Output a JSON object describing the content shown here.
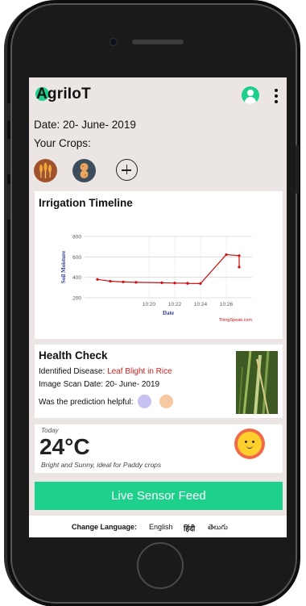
{
  "app": {
    "title": "AgriIoT"
  },
  "header": {
    "date": "Date: 20- June- 2019",
    "crops_label": "Your Crops:"
  },
  "crops": [
    {
      "icon": "wheat-crop-icon"
    },
    {
      "icon": "peanut-crop-icon"
    }
  ],
  "irrigation": {
    "title": "Irrigation Timeline"
  },
  "chart_data": {
    "type": "line",
    "title": "",
    "xlabel": "Date",
    "ylabel": "Soil Moisture",
    "x": [
      "10:16",
      "10:17",
      "10:18",
      "10:19",
      "10:21",
      "10:22",
      "10:23",
      "10:23",
      "10:24",
      "10:26",
      "10:27",
      "10:27"
    ],
    "y": [
      380,
      362,
      355,
      351,
      347,
      344,
      342,
      340,
      339,
      622,
      612,
      500
    ],
    "x_ticks": [
      "10:20",
      "10:22",
      "10:24",
      "10:26"
    ],
    "y_ticks": [
      200,
      400,
      600,
      800
    ],
    "ylim": [
      200,
      800
    ],
    "color": "#cc1010",
    "watermark": "ThingSpeak.com",
    "grid": true
  },
  "health": {
    "title": "Health Check",
    "disease_label": "Identified Disease: ",
    "disease_value": "Leaf Blight in Rice",
    "scan_date": "Image Scan Date: 20- June- 2019",
    "helpful_question": "Was the prediction helpful:"
  },
  "weather": {
    "day": "Today",
    "temperature": "24°C",
    "description": "Bright and Sunny, ideal for Paddy crops"
  },
  "live_button": "Live Sensor Feed",
  "language": {
    "label": "Change Language:",
    "options": [
      "English",
      "हिंदी",
      "తెలుగు"
    ]
  },
  "colors": {
    "accent": "#1dd08b",
    "alert": "#d0201c",
    "background": "#ebe6e4"
  }
}
